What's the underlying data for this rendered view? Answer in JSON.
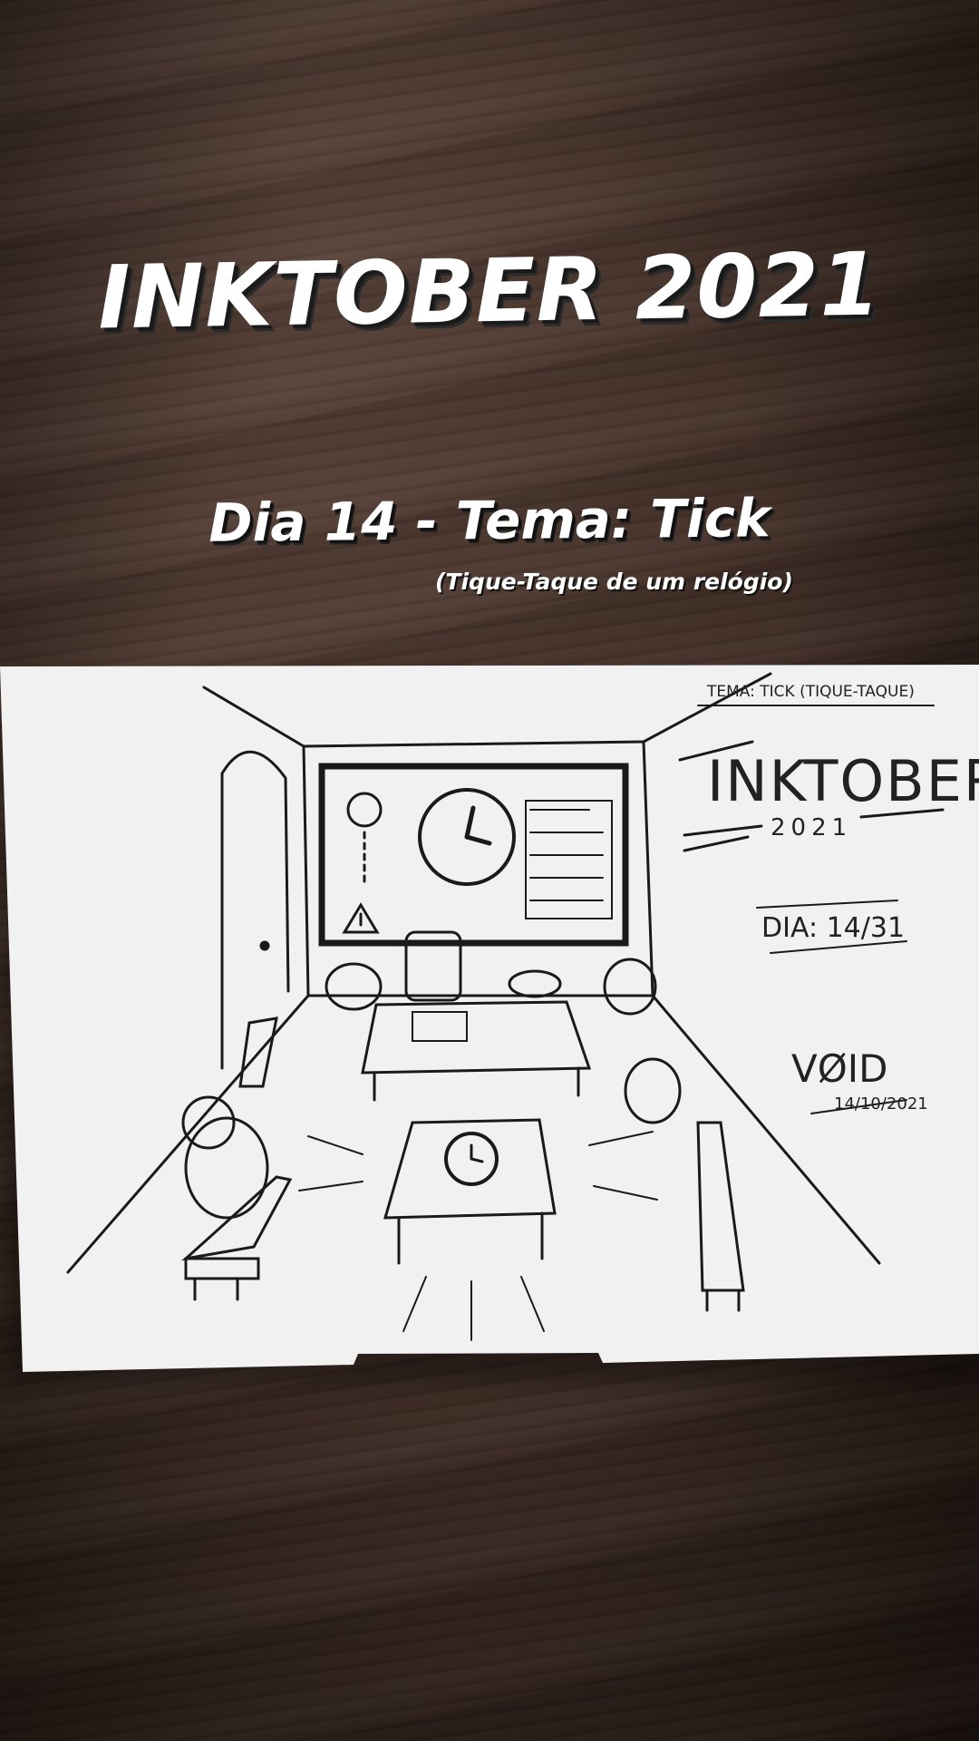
{
  "overlay": {
    "title": "INKTOBER 2021",
    "subtitle": "Dia 14 - Tema: Tick",
    "caption": "(Tique-Taque de um relógio)"
  },
  "drawing": {
    "theme_label": "TEMA: TICK (TIQUE-TAQUE)",
    "brand": "INKTOBER",
    "year": "2021",
    "day": "DIA: 14/31",
    "signature": "VØID",
    "date": "14/10/2021"
  }
}
